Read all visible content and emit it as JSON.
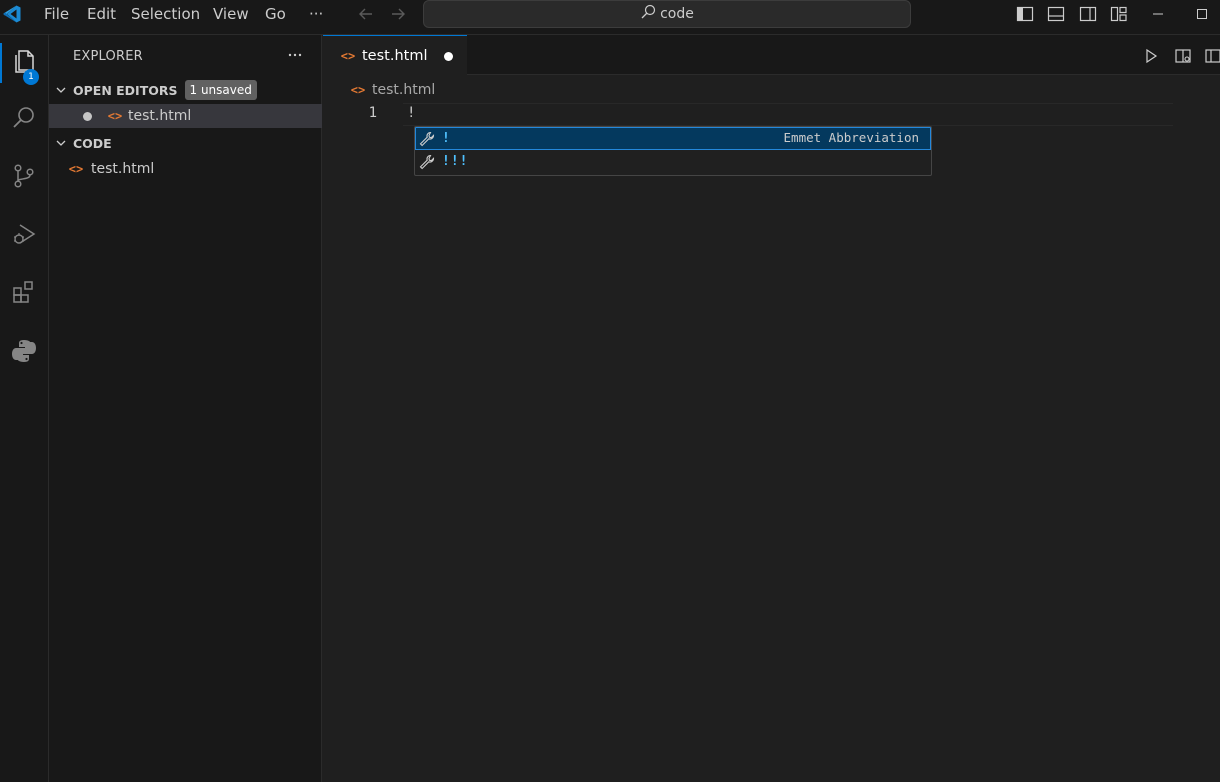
{
  "titlebar": {
    "menu": [
      "File",
      "Edit",
      "Selection",
      "View",
      "Go"
    ],
    "more": "···",
    "search": "code"
  },
  "activitybar": {
    "items": [
      "explorer-icon",
      "search-icon",
      "source-control-icon",
      "run-debug-icon",
      "extensions-icon",
      "python-icon"
    ],
    "explorer_badge": "1"
  },
  "sidebar": {
    "title": "EXPLORER",
    "open_editors": {
      "label": "OPEN EDITORS",
      "badge": "1 unsaved",
      "files": [
        "test.html"
      ]
    },
    "folder": {
      "label": "CODE",
      "files": [
        "test.html"
      ]
    }
  },
  "editor": {
    "tab_label": "test.html",
    "breadcrumb": "test.html",
    "line_number": "1",
    "line_text": "!",
    "suggestions": [
      {
        "label": "!",
        "detail": "Emmet Abbreviation"
      },
      {
        "label": "!!!",
        "detail": ""
      }
    ]
  },
  "colors": {
    "accent": "#0078d4",
    "html_icon": "#e37933",
    "suggest_focus": "#04395e",
    "suggest_label": "#4fc1ff"
  }
}
